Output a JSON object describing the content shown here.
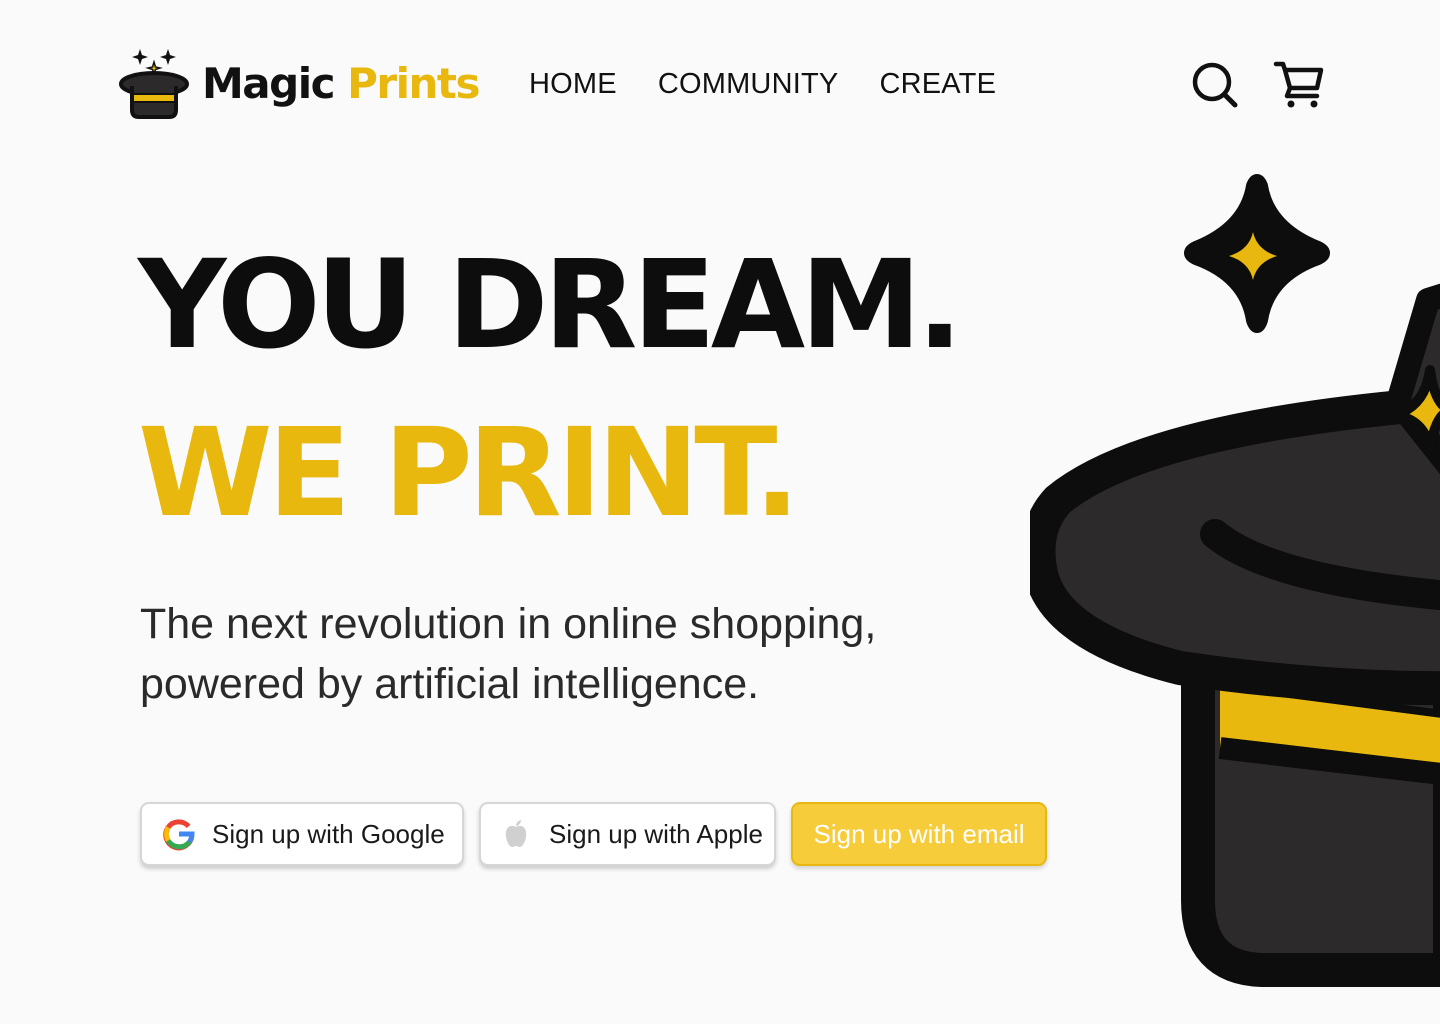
{
  "brand": {
    "word1": "Magic",
    "word2": "Prints",
    "logo_icon": "magic-top-hat-icon"
  },
  "nav": {
    "items": [
      "HOME",
      "COMMUNITY",
      "CREATE"
    ]
  },
  "header_actions": {
    "search_icon": "search-icon",
    "cart_icon": "cart-icon"
  },
  "hero": {
    "headline_1": "YOU DREAM.",
    "headline_2": "WE PRINT.",
    "subtitle": "The next revolution in online shopping, powered by artificial intelligence.",
    "illustration": "magic-top-hat-with-sparkles"
  },
  "signup": {
    "google_label": "Sign up with Google",
    "google_icon": "google-icon",
    "apple_label": "Sign up with Apple",
    "apple_icon": "apple-icon",
    "email_label": "Sign up with email"
  },
  "colors": {
    "background": "#fafafa",
    "text": "#111111",
    "accent_yellow": "#e8b80f",
    "button_yellow": "#f7cc3a",
    "hat_body": "#2d2a2b"
  }
}
